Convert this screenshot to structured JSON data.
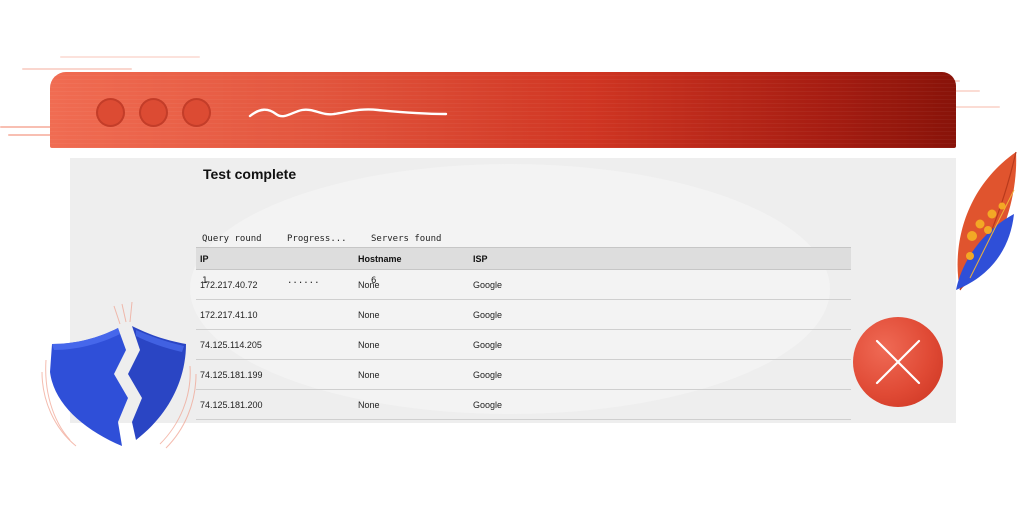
{
  "window": {
    "title_bar_color": "#e2553d",
    "dots": [
      "window-dot",
      "window-dot",
      "window-dot"
    ]
  },
  "main": {
    "title": "Test complete",
    "stats": [
      {
        "label": "Query round",
        "value": "1"
      },
      {
        "label": "Progress...",
        "value": "......"
      },
      {
        "label": "Servers found",
        "value": "6"
      }
    ]
  },
  "table": {
    "headers": {
      "ip": "IP",
      "hostname": "Hostname",
      "isp": "ISP"
    },
    "rows": [
      {
        "ip": "172.217.40.72",
        "hostname": "None",
        "isp": "Google"
      },
      {
        "ip": "172.217.41.10",
        "hostname": "None",
        "isp": "Google"
      },
      {
        "ip": "74.125.114.205",
        "hostname": "None",
        "isp": "Google"
      },
      {
        "ip": "74.125.181.199",
        "hostname": "None",
        "isp": "Google"
      },
      {
        "ip": "74.125.181.200",
        "hostname": "None",
        "isp": "Google"
      }
    ]
  },
  "decor": {
    "shield_icon": "broken-shield-icon",
    "close_icon": "close-icon",
    "accent": "#e04a35",
    "shield_color": "#2f4fd8"
  }
}
